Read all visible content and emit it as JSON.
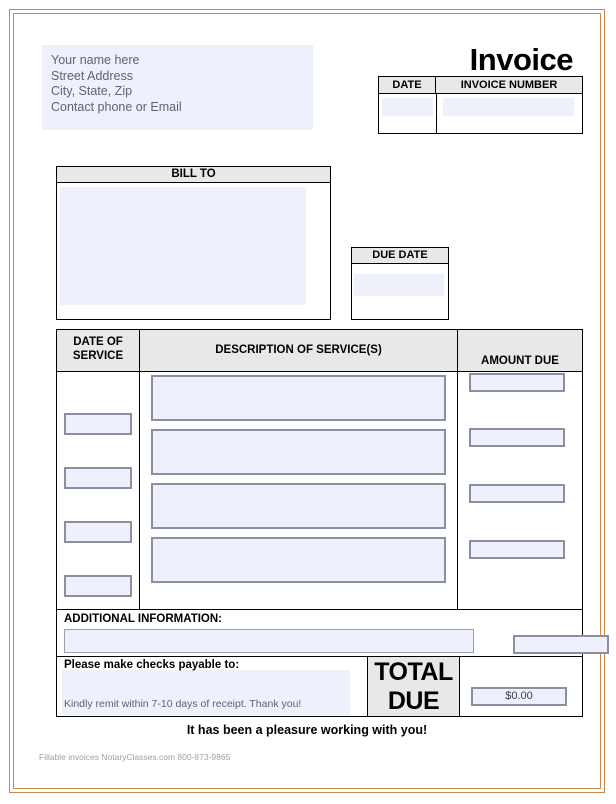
{
  "document": {
    "title": "Invoice",
    "frame_color": "#c58c49",
    "field_fill": "#eef0fb",
    "header_fill": "#e8e8e8"
  },
  "sender": {
    "lines": [
      "Your name here",
      "Street Address",
      "City, State, Zip",
      "Contact phone or Email"
    ],
    "value": ""
  },
  "meta_table": {
    "date_label": "DATE",
    "invoice_number_label": "INVOICE NUMBER",
    "date_value": "",
    "invoice_number_value": ""
  },
  "bill_to": {
    "label": "BILL TO",
    "value": ""
  },
  "due_date": {
    "label": "DUE DATE",
    "value": ""
  },
  "services": {
    "columns": {
      "date_of_service": "DATE OF SERVICE",
      "date_of_service_line1": "DATE OF",
      "date_of_service_line2": "SERVICE",
      "description": "DESCRIPTION OF SERVICE(S)",
      "amount_due": "AMOUNT DUE"
    },
    "rows": [
      {
        "date": "",
        "description": "",
        "amount": ""
      },
      {
        "date": "",
        "description": "",
        "amount": ""
      },
      {
        "date": "",
        "description": "",
        "amount": ""
      },
      {
        "date": "",
        "description": "",
        "amount": ""
      }
    ]
  },
  "additional_information": {
    "label": "ADDITIONAL INFORMATION:",
    "value": "",
    "subtotal_value": ""
  },
  "payment": {
    "payable_label": "Please make checks payable to:",
    "payable_value": "",
    "remit_note": "Kindly remit within 7-10 days of receipt. Thank you!",
    "total_due_line1": "TOTAL",
    "total_due_line2": "DUE",
    "total_due_value": "$0.00"
  },
  "closing": {
    "message": "It has been a pleasure working with you!"
  },
  "footer": {
    "note": "Fillable invoices NotaryClasses.com 800-873-9865"
  }
}
